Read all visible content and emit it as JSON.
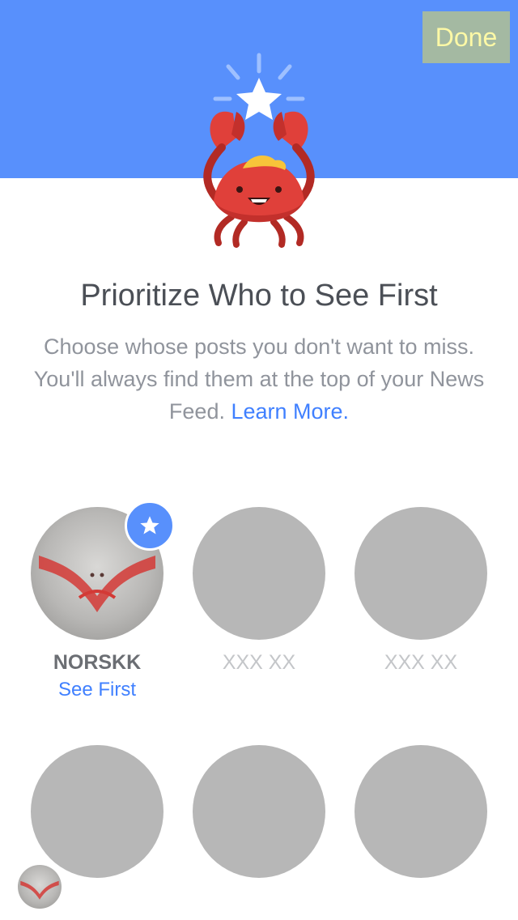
{
  "header": {
    "done_label": "Done",
    "band_color": "#5890fc"
  },
  "intro": {
    "title": "Prioritize Who to See First",
    "body": "Choose whose posts you don't want to miss. You'll always find them at the top of your News Feed.",
    "learn_more": "Learn More."
  },
  "friends": [
    {
      "name": "NORSKK",
      "status": "See First",
      "selected": true
    },
    {
      "name": "XXX XX",
      "status": "",
      "selected": false
    },
    {
      "name": "XXX XX",
      "status": "",
      "selected": false
    },
    {
      "name": "",
      "status": "",
      "selected": false
    },
    {
      "name": "",
      "status": "",
      "selected": false
    },
    {
      "name": "",
      "status": "",
      "selected": false
    }
  ],
  "icons": {
    "mascot": "crab-holding-star-icon",
    "badge": "star-icon"
  }
}
